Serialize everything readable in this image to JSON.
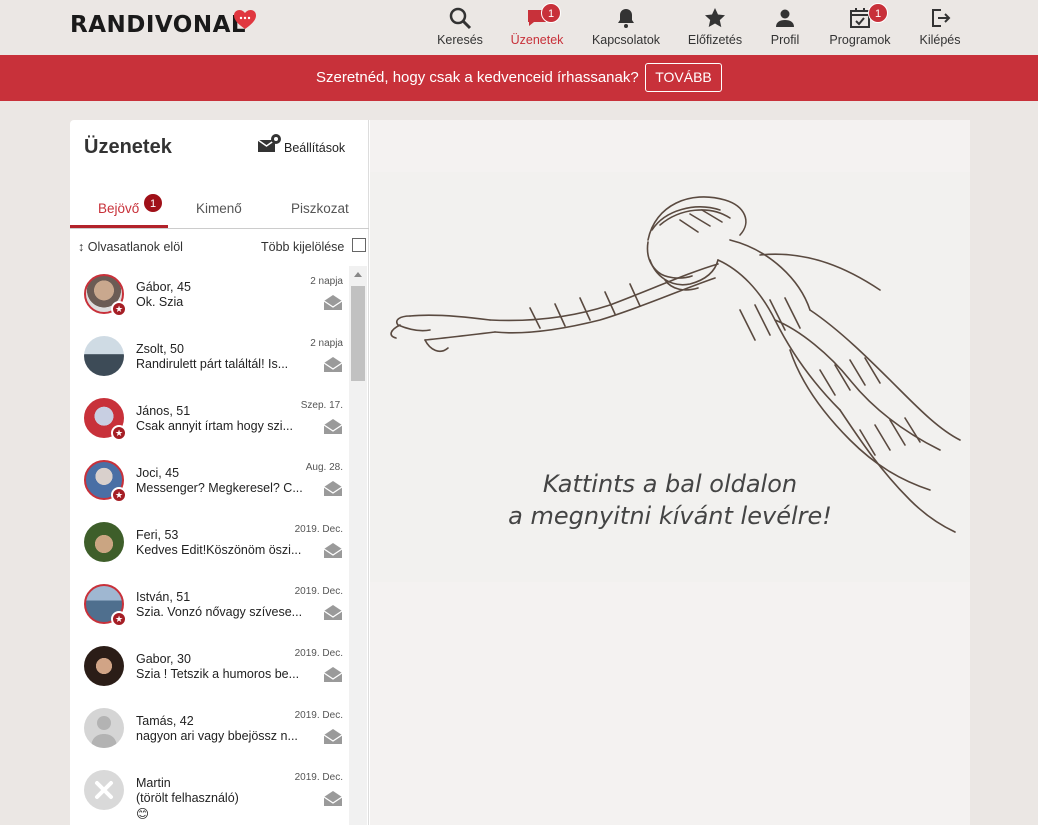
{
  "brand": {
    "name": "RANDIVONAL",
    "accent": "#c8313a"
  },
  "nav": [
    {
      "label": "Keresés",
      "icon": "search-icon"
    },
    {
      "label": "Üzenetek",
      "icon": "chat-icon",
      "badge": "1",
      "active": true
    },
    {
      "label": "Kapcsolatok",
      "icon": "bell-icon"
    },
    {
      "label": "Előfizetés",
      "icon": "star-icon"
    },
    {
      "label": "Profil",
      "icon": "user-icon"
    },
    {
      "label": "Programok",
      "icon": "calendar-icon",
      "badge": "1"
    },
    {
      "label": "Kilépés",
      "icon": "logout-icon"
    }
  ],
  "promo": {
    "text": "Szeretnéd, hogy csak a kedvenceid írhassanak?",
    "button": "TOVÁBB"
  },
  "messages": {
    "title": "Üzenetek",
    "settings_label": "Beállítások",
    "tabs": [
      {
        "label": "Bejövő",
        "badge": "1"
      },
      {
        "label": "Kimenő"
      },
      {
        "label": "Piszkozat"
      }
    ],
    "sort_label": "Olvasatlanok elöl",
    "multi_select_label": "Több kijelölése",
    "items": [
      {
        "name": "Gábor, 45",
        "snippet": "Ok. Szia",
        "date": "2 napja",
        "premium": true
      },
      {
        "name": "Zsolt, 50",
        "snippet": "Randirulett párt találtál! Is...",
        "date": "2 napja",
        "premium": false
      },
      {
        "name": "János, 51",
        "snippet": "Csak annyit írtam hogy szi...",
        "date": "Szep. 17.",
        "premium": true
      },
      {
        "name": "Joci, 45",
        "snippet": "Messenger? Megkeresel? C...",
        "date": "Aug. 28.",
        "premium": true
      },
      {
        "name": "Feri, 53",
        "snippet": "Kedves Edit!Köszönöm öszi...",
        "date": "2019. Dec.",
        "premium": false
      },
      {
        "name": "István, 51",
        "snippet": "Szia. Vonzó nővagy szívese...",
        "date": "2019. Dec.",
        "premium": true
      },
      {
        "name": "Gabor, 30",
        "snippet": "Szia ! Tetszik a humoros be...",
        "date": "2019. Dec.",
        "premium": false
      },
      {
        "name": "Tamás, 42",
        "snippet": "nagyon ari vagy bbejössz n...",
        "date": "2019. Dec.",
        "premium": false
      },
      {
        "name": "Martin",
        "snippet": "(törölt felhasználó)",
        "date": "2019. Dec.",
        "premium": false,
        "emoji": "😊"
      }
    ]
  },
  "empty_state": {
    "line1": "Kattints a bal oldalon",
    "line2": "a megnyitni kívánt levélre!"
  }
}
